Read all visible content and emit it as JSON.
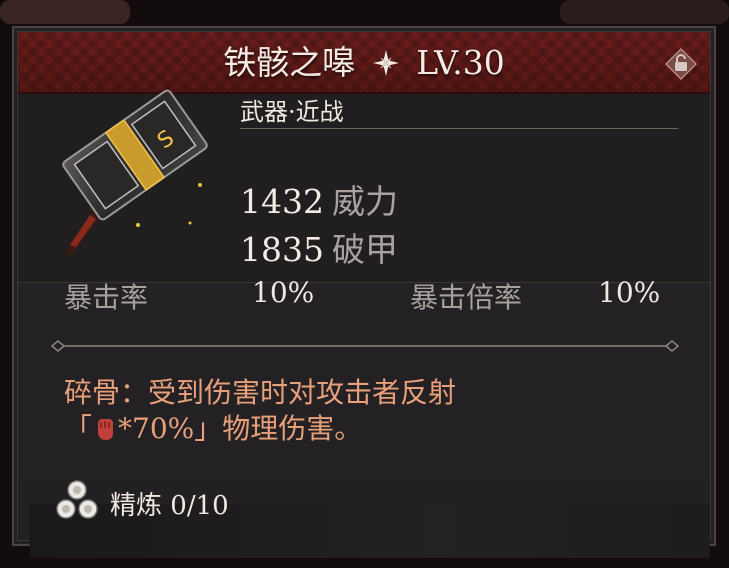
{
  "item": {
    "name": "铁骸之嗥",
    "level": "LV.30",
    "type": "武器·近战",
    "stats": [
      {
        "value": "1432",
        "label": "威力"
      },
      {
        "value": "1835",
        "label": "破甲"
      }
    ],
    "crit_rate_label": "暴击率",
    "crit_rate_value": "10%",
    "crit_mult_label": "暴击倍率",
    "crit_mult_value": "10%",
    "effect_line1": "碎骨：受到伤害时对攻击者反射",
    "effect_line2_prefix": "「",
    "effect_line2_suffix": "*70%」物理伤害。",
    "refine_label": "精炼",
    "refine_value": "0/10"
  },
  "icons": {
    "star": "sparkle-star-icon",
    "lock": "unlocked-padlock-icon",
    "weapon": "hammer-weapon-icon",
    "effect": "fist-icon",
    "refine": "refine-orbs-icon"
  },
  "colors": {
    "header_red": "#6b1e1c",
    "effect_text": "#e8a07a",
    "stat_label": "#a8a3a0",
    "panel_bg": "#222021"
  }
}
